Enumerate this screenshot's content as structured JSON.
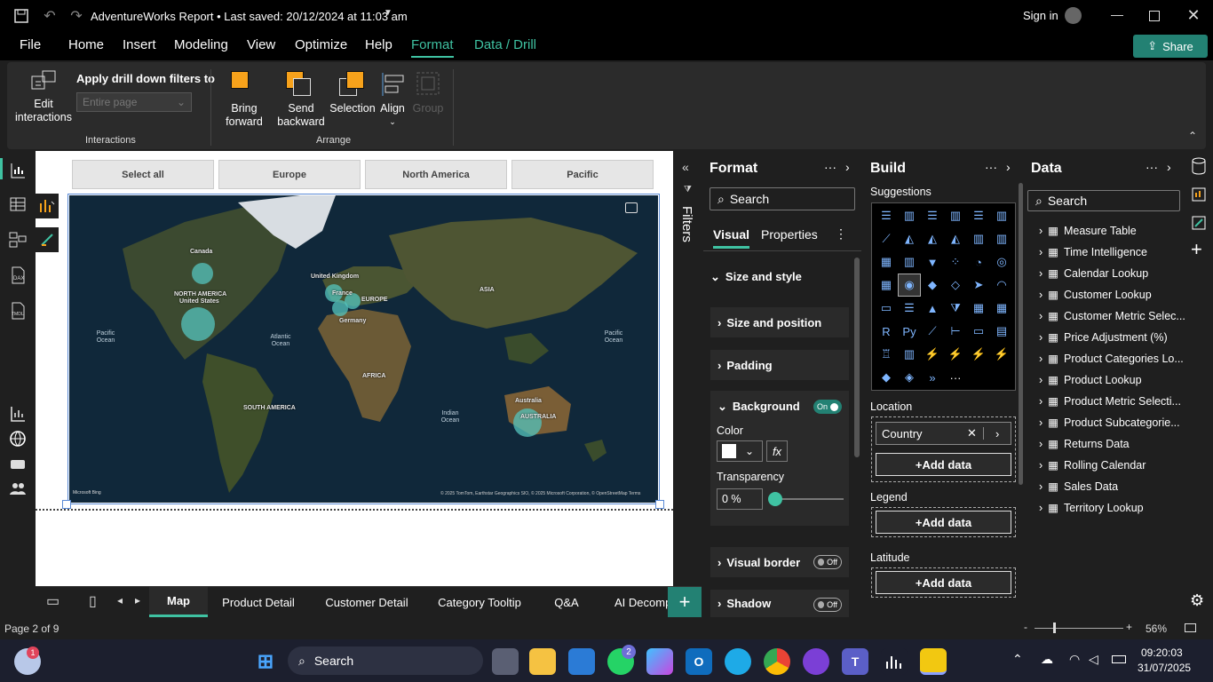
{
  "titlebar": {
    "title": "AdventureWorks Report • Last saved: 20/12/2024 at 11:03 am",
    "sign_in": "Sign in"
  },
  "menu": {
    "items": [
      "File",
      "Home",
      "Insert",
      "Modeling",
      "View",
      "Optimize",
      "Help",
      "Format",
      "Data / Drill"
    ],
    "active": "Format",
    "share": "Share"
  },
  "ribbon": {
    "edit_interactions": "Edit interactions",
    "apply_drill": "Apply drill down filters to",
    "drill_placeholder": "Entire page",
    "interactions_group": "Interactions",
    "bring_forward": "Bring forward",
    "send_backward": "Send backward",
    "selection": "Selection",
    "align": "Align",
    "group": "Group",
    "arrange_group": "Arrange"
  },
  "slicers": [
    "Select all",
    "Europe",
    "North America",
    "Pacific"
  ],
  "map": {
    "labels": [
      "Canada",
      "NORTH AMERICA",
      "United States",
      "United Kingdom",
      "France",
      "EUROPE",
      "Germany",
      "ASIA",
      "AFRICA",
      "SOUTH AMERICA",
      "Australia",
      "AUSTRALIA"
    ],
    "oceans": [
      "Pacific Ocean",
      "Atlantic Ocean",
      "Indian Ocean",
      "Pacific Ocean"
    ],
    "attribution": "© 2025 TomTom, Earthstar Geographics SIO, © 2025 Microsoft Corporation, © OpenStreetMap  Terms",
    "brand": "Microsoft Bing"
  },
  "filters_label": "Filters",
  "format_pane": {
    "title": "Format",
    "search": "Search",
    "tabs": [
      "Visual",
      "Properties"
    ],
    "size_and_style": "Size and style",
    "size_position": "Size and position",
    "padding": "Padding",
    "background": "Background",
    "background_toggle": "On",
    "color_label": "Color",
    "fx": "fx",
    "transparency_label": "Transparency",
    "transparency_value": "0 %",
    "transparency": 0,
    "visual_border": "Visual border",
    "visual_border_toggle": "Off",
    "shadow": "Shadow",
    "shadow_toggle": "Off"
  },
  "build_pane": {
    "title": "Build",
    "suggestions": "Suggestions",
    "location_label": "Location",
    "location_field": "Country",
    "add_data": "+Add data",
    "legend_label": "Legend",
    "latitude_label": "Latitude"
  },
  "data_pane": {
    "title": "Data",
    "search": "Search",
    "tables": [
      "Measure Table",
      "Time Intelligence",
      "Calendar Lookup",
      "Customer Lookup",
      "Customer Metric Selec...",
      "Price Adjustment (%)",
      "Product Categories Lo...",
      "Product Lookup",
      "Product Metric Selecti...",
      "Product Subcategorie...",
      "Returns Data",
      "Rolling Calendar",
      "Sales Data",
      "Territory Lookup"
    ]
  },
  "tabs": [
    "Map",
    "Product Detail",
    "Customer Detail",
    "Category Tooltip",
    "Q&A",
    "AI Decomp"
  ],
  "active_tab": "Map",
  "status": {
    "page": "Page 2 of 9",
    "zoom": "56%"
  },
  "taskbar": {
    "search": "Search",
    "time": "09:20:03",
    "date": "31/07/2025",
    "weather_badge": "1",
    "whatsapp_badge": "2"
  },
  "colors": {
    "accent": "#3fc2a2",
    "share": "#238173",
    "orange": "#f7a21b",
    "bubble": "#54c4be"
  }
}
